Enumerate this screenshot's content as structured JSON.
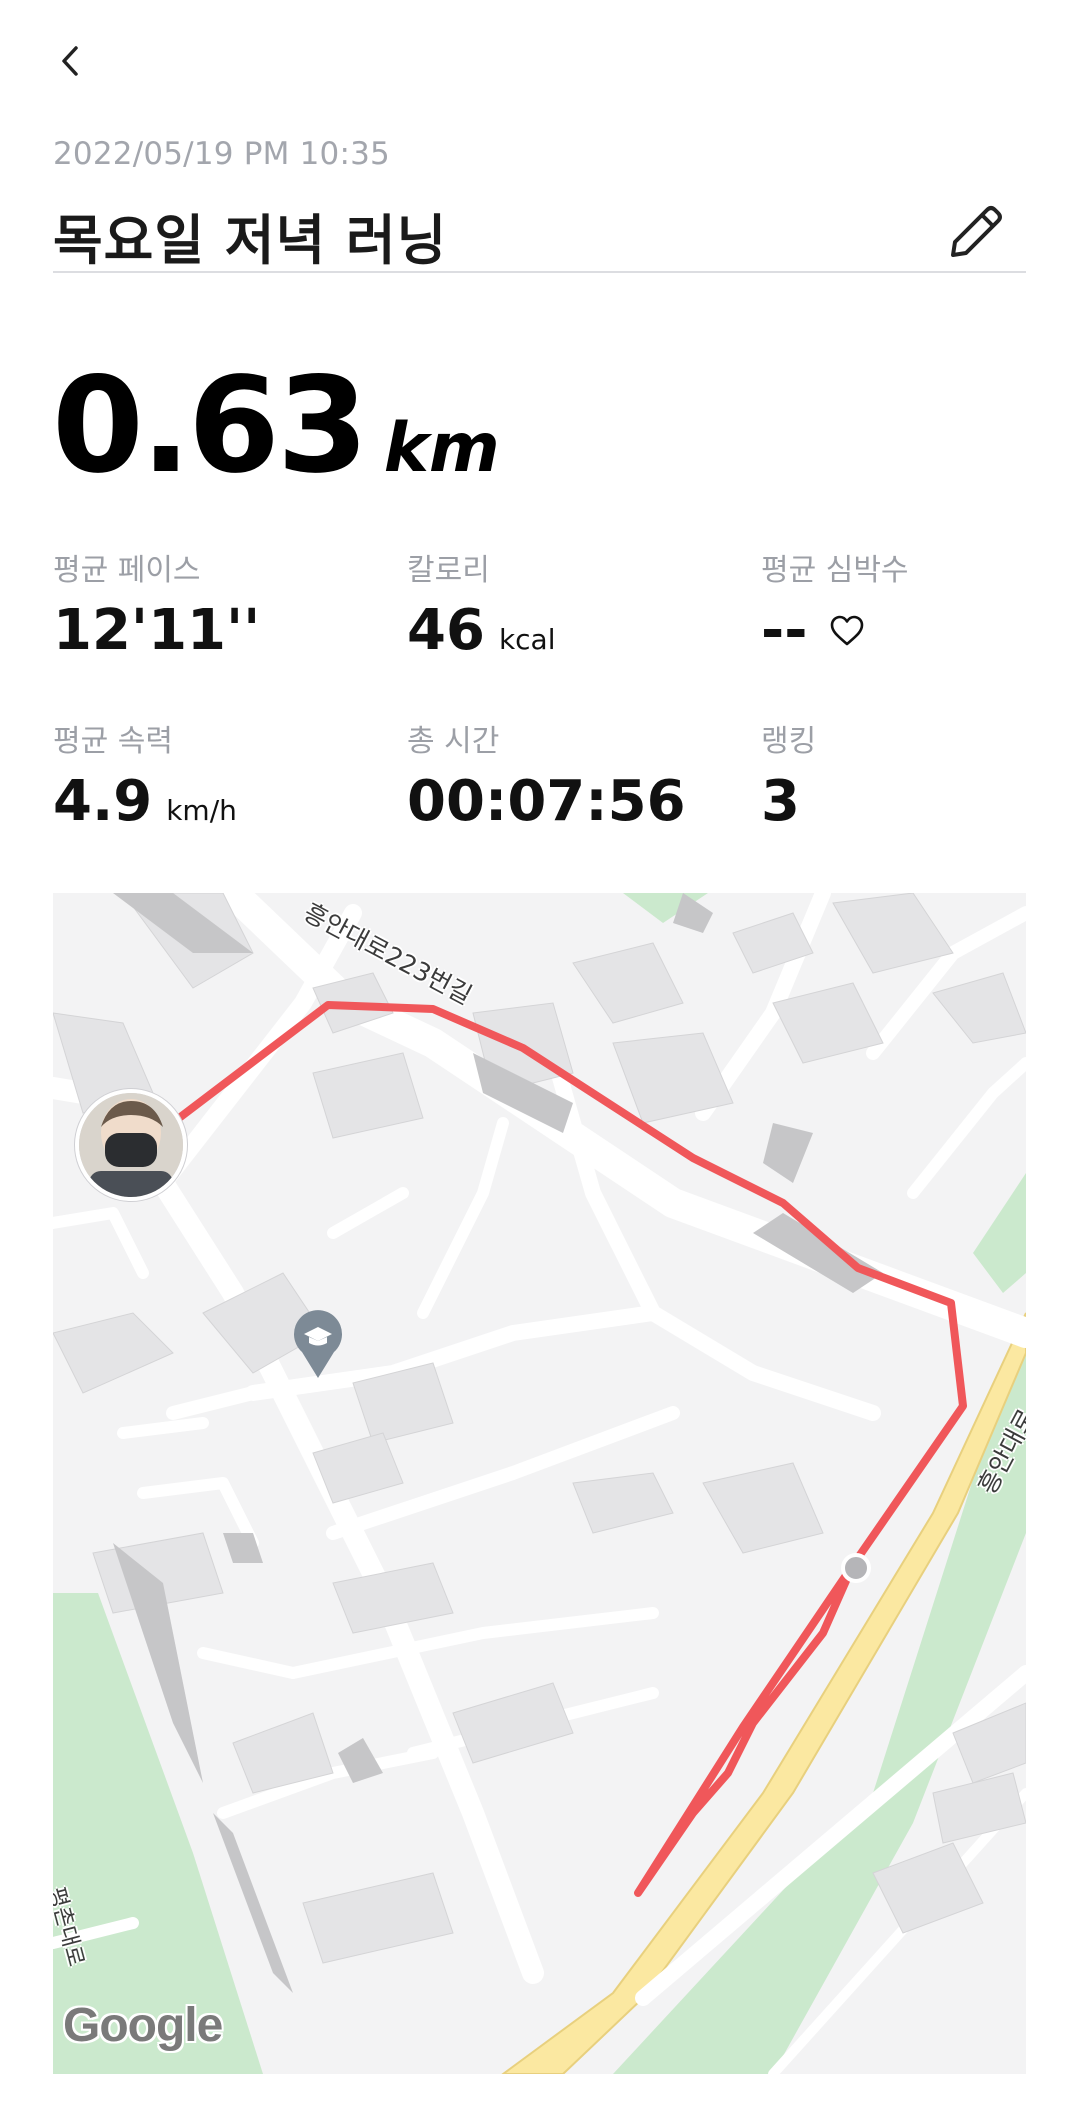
{
  "header": {
    "date": "2022/05/19 PM 10:35",
    "title": "목요일 저녁 러닝"
  },
  "distance": {
    "value": "0.63",
    "unit": "km"
  },
  "stats": [
    {
      "label": "평균 페이스",
      "value": "12'11''",
      "unit": ""
    },
    {
      "label": "칼로리",
      "value": "46",
      "unit": "kcal"
    },
    {
      "label": "평균 심박수",
      "value": "--",
      "unit": ""
    },
    {
      "label": "평균 속력",
      "value": "4.9",
      "unit": "km/h"
    },
    {
      "label": "총 시간",
      "value": "00:07:56",
      "unit": ""
    },
    {
      "label": "랭킹",
      "value": "3",
      "unit": ""
    }
  ],
  "map": {
    "road_labels": [
      "흥안대로223번길",
      "흥안대로",
      "평촌대로"
    ],
    "attribution": "Google",
    "route_color": "#f0575a",
    "park_color": "#cbe9cd",
    "highway_color": "#fbe8a1"
  },
  "icons": {
    "back": "chevron-left-icon",
    "edit": "pencil-icon",
    "heart": "heart-outline-icon",
    "school": "school-pin-icon"
  }
}
